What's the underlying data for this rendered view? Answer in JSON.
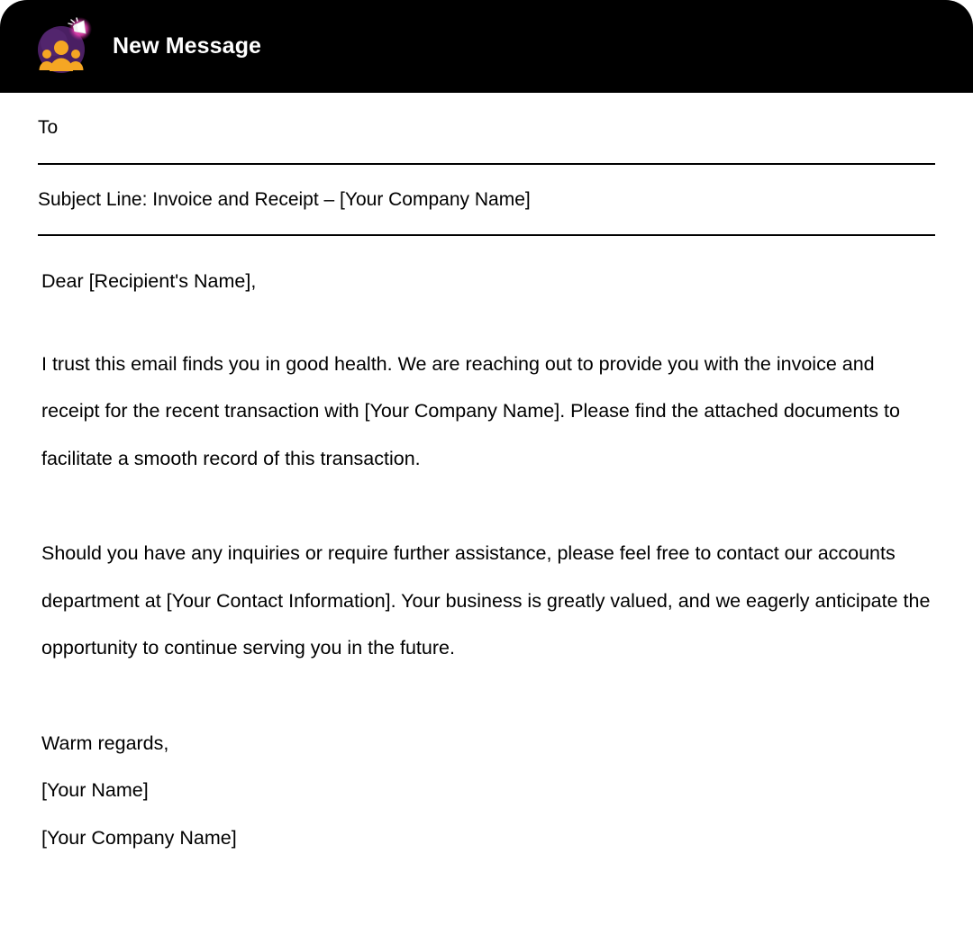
{
  "header": {
    "title": "New Message",
    "logo": {
      "icon_name": "community-megaphone-logo",
      "circle_color": "#4a1f63",
      "people_color": "#f5a623",
      "megaphone_color": "#ffffff",
      "glow_color": "#e83fb0",
      "background": "#000000"
    }
  },
  "compose": {
    "to": {
      "label": "To",
      "value": "",
      "placeholder": "To"
    },
    "subject": {
      "label": "Subject",
      "value": "Subject Line: Invoice and Receipt – [Your Company Name]",
      "placeholder": "Subject"
    }
  },
  "message": {
    "salutation": "Dear [Recipient's Name],",
    "paragraph_1": "I trust this email finds you in good health. We are reaching out to provide you with the invoice and receipt for the recent transaction with [Your Company Name]. Please find the attached documents to facilitate a smooth record of this transaction.",
    "paragraph_2": "Should you have any inquiries or require further assistance, please feel free to contact our accounts department at [Your Contact Information]. Your business is greatly valued, and we eagerly anticipate the opportunity to continue serving you in the future.",
    "signature": {
      "closing": "Warm regards,",
      "name": "[Your Name]",
      "company": "[Your Company Name]"
    }
  }
}
